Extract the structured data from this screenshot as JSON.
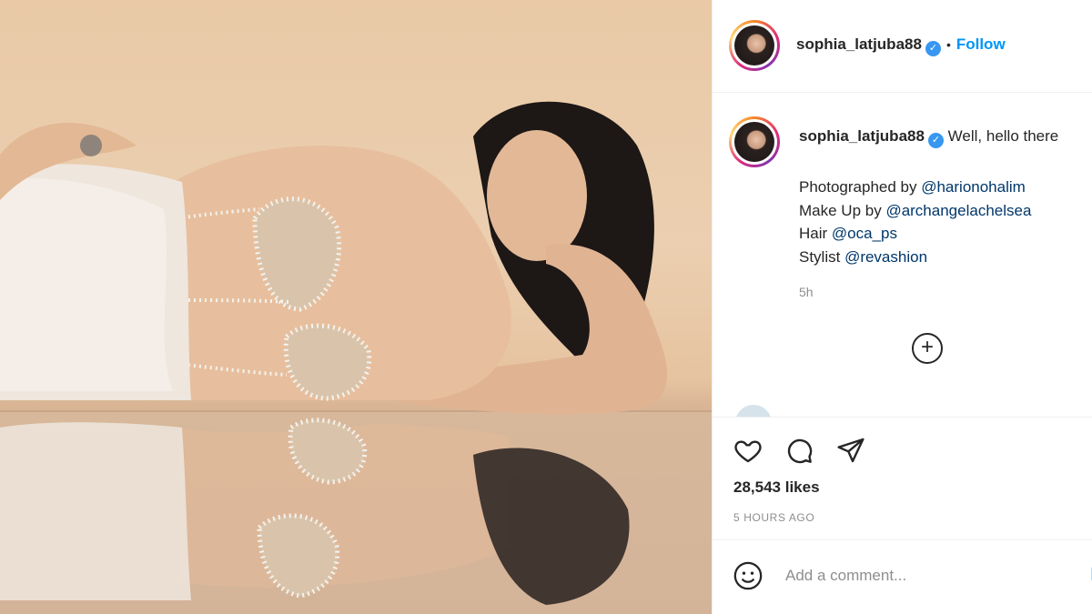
{
  "post": {
    "username": "sophia_latjuba88",
    "follow_label": "Follow",
    "separator": "•",
    "caption_first": "Well, hello there",
    "caption_lines": [
      {
        "prefix": "Photographed by ",
        "mention": "@harionohalim"
      },
      {
        "prefix": "Make Up by ",
        "mention": "@archangelachelsea"
      },
      {
        "prefix": "Hair ",
        "mention": "@oca_ps"
      },
      {
        "prefix": "Stylist ",
        "mention": "@revashion"
      }
    ],
    "time_ago": "5h",
    "load_more_symbol": "+",
    "likes": "28,543 likes",
    "posted": "5 HOURS AGO"
  },
  "comment": {
    "placeholder": "Add a comment..."
  },
  "icons": {
    "like": "heart-icon",
    "comment": "comment-bubble-icon",
    "share": "paper-plane-icon",
    "emoji": "smiley-icon",
    "verified": "verified-badge-icon",
    "load_more": "plus-circle-icon"
  },
  "colors": {
    "link_blue": "#0095f6",
    "verified_blue": "#3897f0",
    "mention": "#00376b",
    "muted": "#8e8e8e"
  }
}
